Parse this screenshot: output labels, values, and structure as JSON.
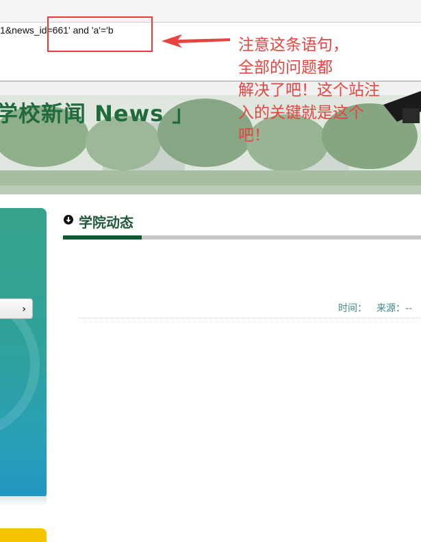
{
  "address_bar": {
    "url_fragment": "1&news_id=661' and 'a'='b"
  },
  "banner": {
    "title": "学校新闻 News 」"
  },
  "section": {
    "title": "学院动态"
  },
  "article_meta": {
    "time_label": "时间：",
    "source_label": "来源：--"
  },
  "annotation": {
    "lines": [
      "注意这条语句，",
      "全部的问题都",
      "解决了吧！这个站注",
      "入的关键就是这个",
      "吧！"
    ]
  },
  "colors": {
    "annotation_red": "#e8443f",
    "brand_green": "#0f5a34",
    "meta_teal": "#3f8a86"
  },
  "icons": {
    "section": "circle-down-arrow-icon",
    "arrow": "left-arrow-icon",
    "chevron": "chevron-right-icon"
  }
}
